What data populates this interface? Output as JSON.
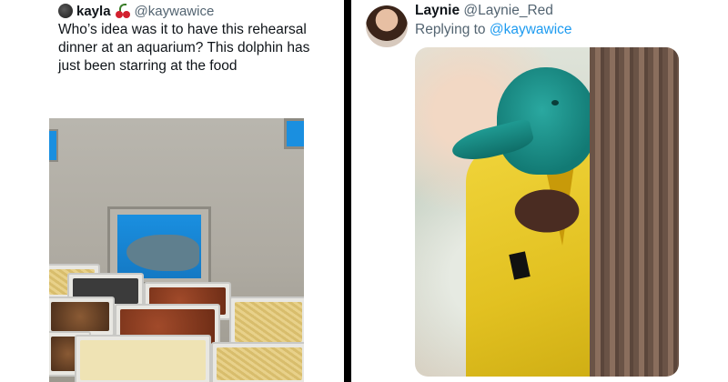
{
  "left_tweet": {
    "display_name": "kayla",
    "handle": "@kaywawice",
    "text": "Who’s idea was it to have this rehearsal dinner at an aquarium? This dolphin has just been starring at the food",
    "icons": [
      "avatar",
      "cherry-emoji"
    ]
  },
  "right_tweet": {
    "display_name": "Laynie",
    "handle": "@Laynie_Red",
    "replying_to_label": "Replying to",
    "replying_to_handle": "@kaywawice",
    "icons": [
      "avatar"
    ]
  },
  "colors": {
    "divider": "#000000",
    "link": "#1d9bf0",
    "secondary_text": "#536471",
    "primary_text": "#0f1419"
  }
}
